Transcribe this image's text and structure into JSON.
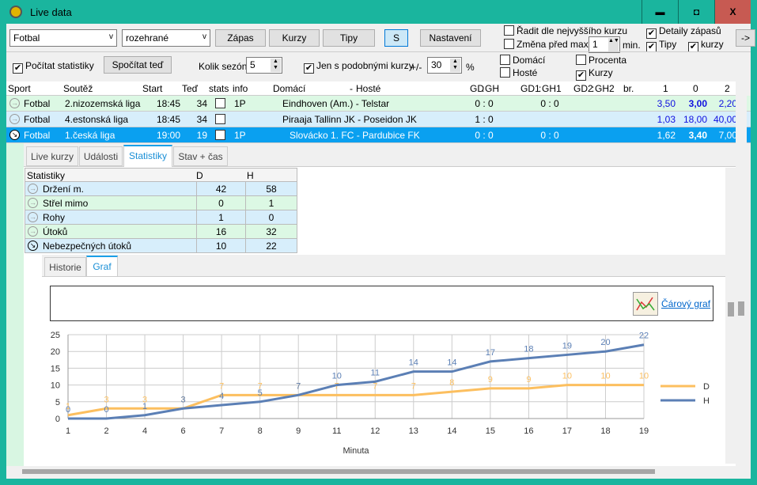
{
  "window": {
    "title": "Live data",
    "minimize": "▬",
    "maximize": "◘",
    "close": "X"
  },
  "toolbar": {
    "sport": "Fotbal",
    "filter": "rozehrané",
    "zapas": "Zápas",
    "kurzy": "Kurzy",
    "tipy": "Tipy",
    "s": "S",
    "nastaveni": "Nastavení",
    "radit": "Řadit dle nejvyššího kurzu",
    "zmena": "Změna před max.",
    "zmena_val": "1",
    "min": "min.",
    "detaily": "Detaily zápasů",
    "tipy_cb": "Tipy",
    "kurzy_cb": "kurzy",
    "arrow": "->",
    "pocitat": "Počítat statistiky",
    "spocitat": "Spočítat teď",
    "kolik": "Kolik sezón",
    "kolik_val": "5",
    "jen": "Jen s podobnými kurzy",
    "pm": "+/-",
    "pm_val": "30",
    "pct": "%",
    "domaci": "Domácí",
    "hoste": "Hosté",
    "procenta": "Procenta",
    "kurzy2": "Kurzy"
  },
  "grid": {
    "headers": [
      "Sport",
      "Soutěž",
      "Start",
      "Teď",
      "stats",
      "info",
      "Domácí",
      "-",
      "Hosté",
      "GD",
      ":",
      "GH",
      "GD1",
      ":",
      "GH1",
      "GD2",
      ":",
      "GH2",
      "br.",
      "1",
      "0",
      "2"
    ],
    "rows": [
      {
        "sport": "Fotbal",
        "league": "2.nizozemská liga",
        "start": "18:45",
        "now": "34",
        "info": "1P",
        "match": "Eindhoven (Am.) - Telstar",
        "score": "0 : 0",
        "score1": "0 : 0",
        "o1": "3,50",
        "o0": "3,00",
        "o2": "2,20",
        "bg": "#dcf8e4"
      },
      {
        "sport": "Fotbal",
        "league": "4.estonská liga",
        "start": "18:45",
        "now": "34",
        "info": "",
        "match": "Piraaja Tallinn JK - Poseidon JK",
        "score": "1 : 0",
        "score1": "",
        "o1": "1,03",
        "o0": "18,00",
        "o2": "40,00",
        "bg": "#d7eefb"
      },
      {
        "sport": "Fotbal",
        "league": "1.česká liga",
        "start": "19:00",
        "now": "19",
        "info": "1P",
        "match": "Slovácko 1. FC - Pardubice FK",
        "score": "0 : 0",
        "score1": "0 : 0",
        "o1": "1,62",
        "o0": "3,40",
        "o2": "7,00",
        "bg": "#0aa0f0"
      }
    ]
  },
  "detail_tabs": [
    "Live kurzy",
    "Události",
    "Statistiky",
    "Stav + čas"
  ],
  "stats": {
    "headers": [
      "Statistiky",
      "D",
      "H"
    ],
    "rows": [
      {
        "label": "Držení m.",
        "d": "42",
        "h": "58"
      },
      {
        "label": "Střel mimo",
        "d": "0",
        "h": "1"
      },
      {
        "label": "Rohy",
        "d": "1",
        "h": "0"
      },
      {
        "label": "Útoků",
        "d": "16",
        "h": "32"
      },
      {
        "label": "Nebezpečných útoků",
        "d": "10",
        "h": "22"
      }
    ]
  },
  "inner_tabs": [
    "Historie",
    "Graf"
  ],
  "chart_link": "Čárový graf",
  "colors": {
    "D": "#fcbf5f",
    "H": "#5b7fb5",
    "title_bar": "#1ab59e",
    "selected_row": "#0aa0f0"
  },
  "chart_data": {
    "type": "line",
    "categories": [
      "1",
      "2",
      "4",
      "6",
      "7",
      "8",
      "9",
      "11",
      "12",
      "13",
      "14",
      "15",
      "16",
      "17",
      "18",
      "19"
    ],
    "series": [
      {
        "name": "D",
        "values": [
          1,
          3,
          3,
          3,
          7,
          7,
          7,
          7,
          7,
          7,
          8,
          9,
          9,
          10,
          10,
          10
        ]
      },
      {
        "name": "H",
        "values": [
          0,
          0,
          1,
          3,
          4,
          5,
          7,
          10,
          11,
          14,
          14,
          17,
          18,
          19,
          20,
          22
        ]
      }
    ],
    "xlabel": "Minuta",
    "ylim": [
      0,
      25
    ],
    "yticks": [
      "0",
      "5",
      "10",
      "15",
      "20",
      "25"
    ],
    "grid": true,
    "legend": "right",
    "data_labels": true
  }
}
